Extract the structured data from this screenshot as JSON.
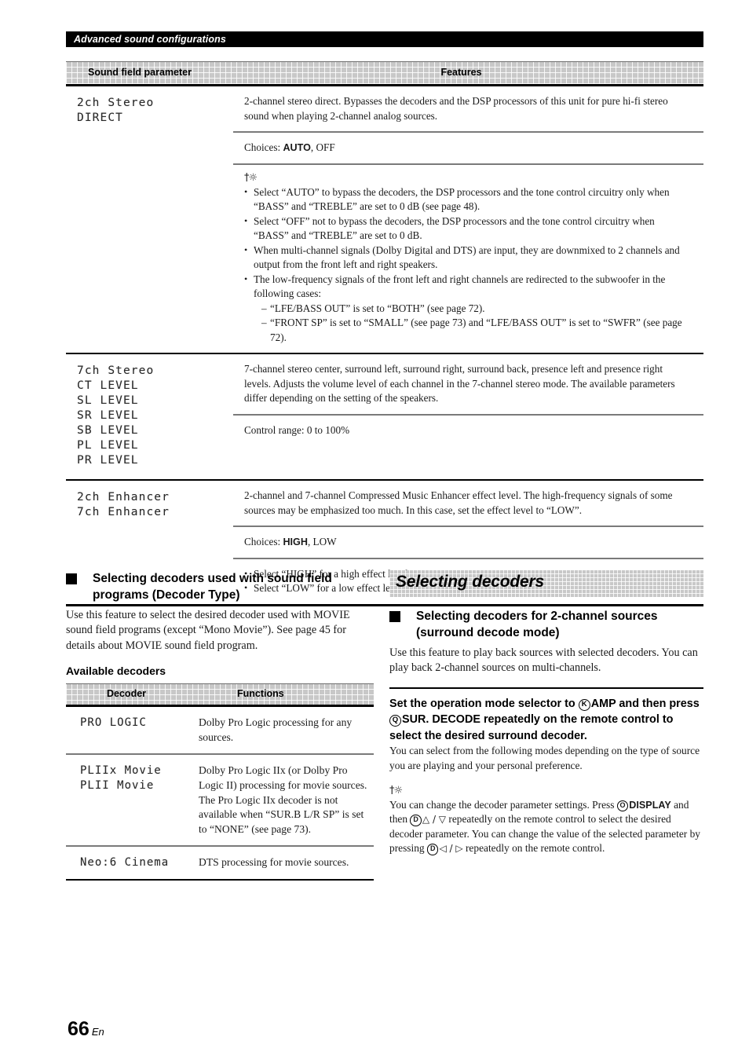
{
  "section_bar": {
    "title": "Advanced sound configurations"
  },
  "main_table": {
    "headers": {
      "col1": "Sound field parameter",
      "col2": "Features"
    },
    "rows": [
      {
        "param_lines": [
          "2ch Stereo",
          "DIRECT"
        ],
        "cells": [
          {
            "type": "text",
            "text": "2-channel stereo direct. Bypasses the decoders and the DSP processors of this unit for pure hi-fi stereo sound when playing 2-channel analog sources."
          },
          {
            "type": "choices",
            "label": "Choices:",
            "bold_value": "AUTO",
            "rest": ", OFF"
          },
          {
            "type": "tip_bullets",
            "tip_icon": "sparkle-icon",
            "bullets": [
              "Select “AUTO” to bypass the decoders, the DSP processors and the tone control circuitry only when “BASS” and “TREBLE” are set to 0 dB (see page 48).",
              "Select “OFF” not to bypass the decoders, the DSP processors and the tone control circuitry when “BASS” and “TREBLE” are set to 0 dB.",
              "When multi-channel signals (Dolby Digital and DTS) are input, they are downmixed to 2 channels and output from the front left and right speakers."
            ],
            "last_bullet": "The low-frequency signals of the front left and right channels are redirected to the subwoofer in the following cases:",
            "sub_items": [
              "“LFE/BASS OUT” is set to “BOTH” (see page 72).",
              "“FRONT SP” is set to “SMALL” (see page 73) and “LFE/BASS OUT” is set to “SWFR” (see page 72)."
            ]
          }
        ]
      },
      {
        "param_lines": [
          "7ch Stereo",
          "CT LEVEL",
          "SL LEVEL",
          "SR LEVEL",
          "SB LEVEL",
          "PL LEVEL",
          "PR LEVEL"
        ],
        "cells": [
          {
            "type": "text",
            "text": "7-channel stereo center, surround left, surround right, surround back, presence left and presence right levels. Adjusts the volume level of each channel in the 7-channel stereo mode. The available parameters differ depending on the setting of the speakers."
          },
          {
            "type": "text",
            "text": "Control range: 0 to 100%"
          }
        ]
      },
      {
        "param_lines": [
          "2ch Enhancer",
          "7ch Enhancer"
        ],
        "cells": [
          {
            "type": "text",
            "text": "2-channel and 7-channel Compressed Music Enhancer effect level. The high-frequency signals of some sources may be emphasized too much. In this case, set the effect level to “LOW”."
          },
          {
            "type": "choices",
            "label": "Choices:",
            "bold_value": "HIGH",
            "rest": ", LOW"
          },
          {
            "type": "bullets",
            "bullets": [
              "Select “HIGH” for a high effect level.",
              "Select “LOW” for a low effect level."
            ]
          }
        ]
      }
    ]
  },
  "left_column": {
    "heading": "Selecting decoders used with sound field programs (Decoder Type)",
    "body": "Use this feature to select the desired decoder used with MOVIE sound field programs (except “Mono Movie”). See page 45 for details about MOVIE sound field program.",
    "subheading": "Available decoders",
    "decoder_table": {
      "headers": {
        "col1": "Decoder",
        "col2": "Functions"
      },
      "rows": [
        {
          "decoder_lines": [
            "PRO LOGIC"
          ],
          "function": "Dolby Pro Logic processing for any sources."
        },
        {
          "decoder_lines": [
            "PLIIx Movie",
            "PLII Movie"
          ],
          "function": "Dolby Pro Logic IIx (or Dolby Pro Logic II) processing for movie sources. The Pro Logic IIx decoder is not available when “SUR.B L/R SP” is set to “NONE” (see page 73)."
        },
        {
          "decoder_lines": [
            "Neo:6 Cinema"
          ],
          "function": "DTS processing for movie sources."
        }
      ]
    }
  },
  "right_column": {
    "banner": "Selecting decoders",
    "heading": "Selecting decoders for 2-channel sources (surround decode mode)",
    "body": "Use this feature to play back sources with selected decoders. You can play back 2-channel sources on multi-channels.",
    "instruction": {
      "part1": "Set the operation mode selector to ",
      "circle1": "K",
      "part2": "AMP",
      "part3": " and then press ",
      "circle2": "Q",
      "part4": "SUR. DECODE",
      "part5": " repeatedly on the remote control to select the desired surround decoder."
    },
    "body2": "You can select from the following modes depending on the type of source you are playing and your personal preference.",
    "tip_icon": "sparkle-icon",
    "tip": {
      "part1": "You can change the decoder parameter settings. Press ",
      "circle1": "O",
      "bold1": "DISPLAY",
      "part2": " and then ",
      "circle2": "D",
      "arrows1": "△ / ▽",
      "part3": " repeatedly on the remote control to select the desired decoder parameter. You can change the value of the selected parameter by pressing ",
      "circle3": "D",
      "arrows2": "◁ / ▷",
      "part4": " repeatedly on the remote control."
    }
  },
  "footer": {
    "page_number": "66",
    "lang": "En"
  }
}
